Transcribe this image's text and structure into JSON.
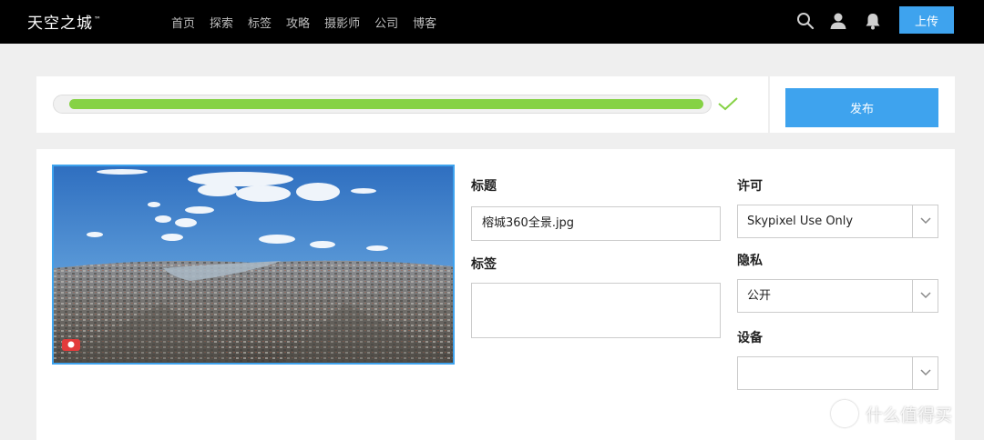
{
  "header": {
    "logo": "天空之城",
    "logo_mark": "™",
    "nav": [
      "首页",
      "探索",
      "标签",
      "攻略",
      "摄影师",
      "公司",
      "博客"
    ],
    "upload_label": "上传",
    "icons": [
      "search-icon",
      "user-icon",
      "bell-icon"
    ]
  },
  "upload": {
    "progress": 1.0,
    "status_icon": "check-icon",
    "publish_label": "发布"
  },
  "form": {
    "title_label": "标题",
    "title_value": "榕城360全景.jpg",
    "tags_label": "标签",
    "tags_value": "",
    "license_label": "许可",
    "license_value": "Skypixel Use Only",
    "privacy_label": "隐私",
    "privacy_value": "公开",
    "device_label": "设备",
    "device_value": ""
  },
  "watermark": {
    "text": "什么值得买"
  },
  "colors": {
    "accent": "#3ea3ee",
    "progress": "#86d245",
    "topbar": "#000000"
  }
}
